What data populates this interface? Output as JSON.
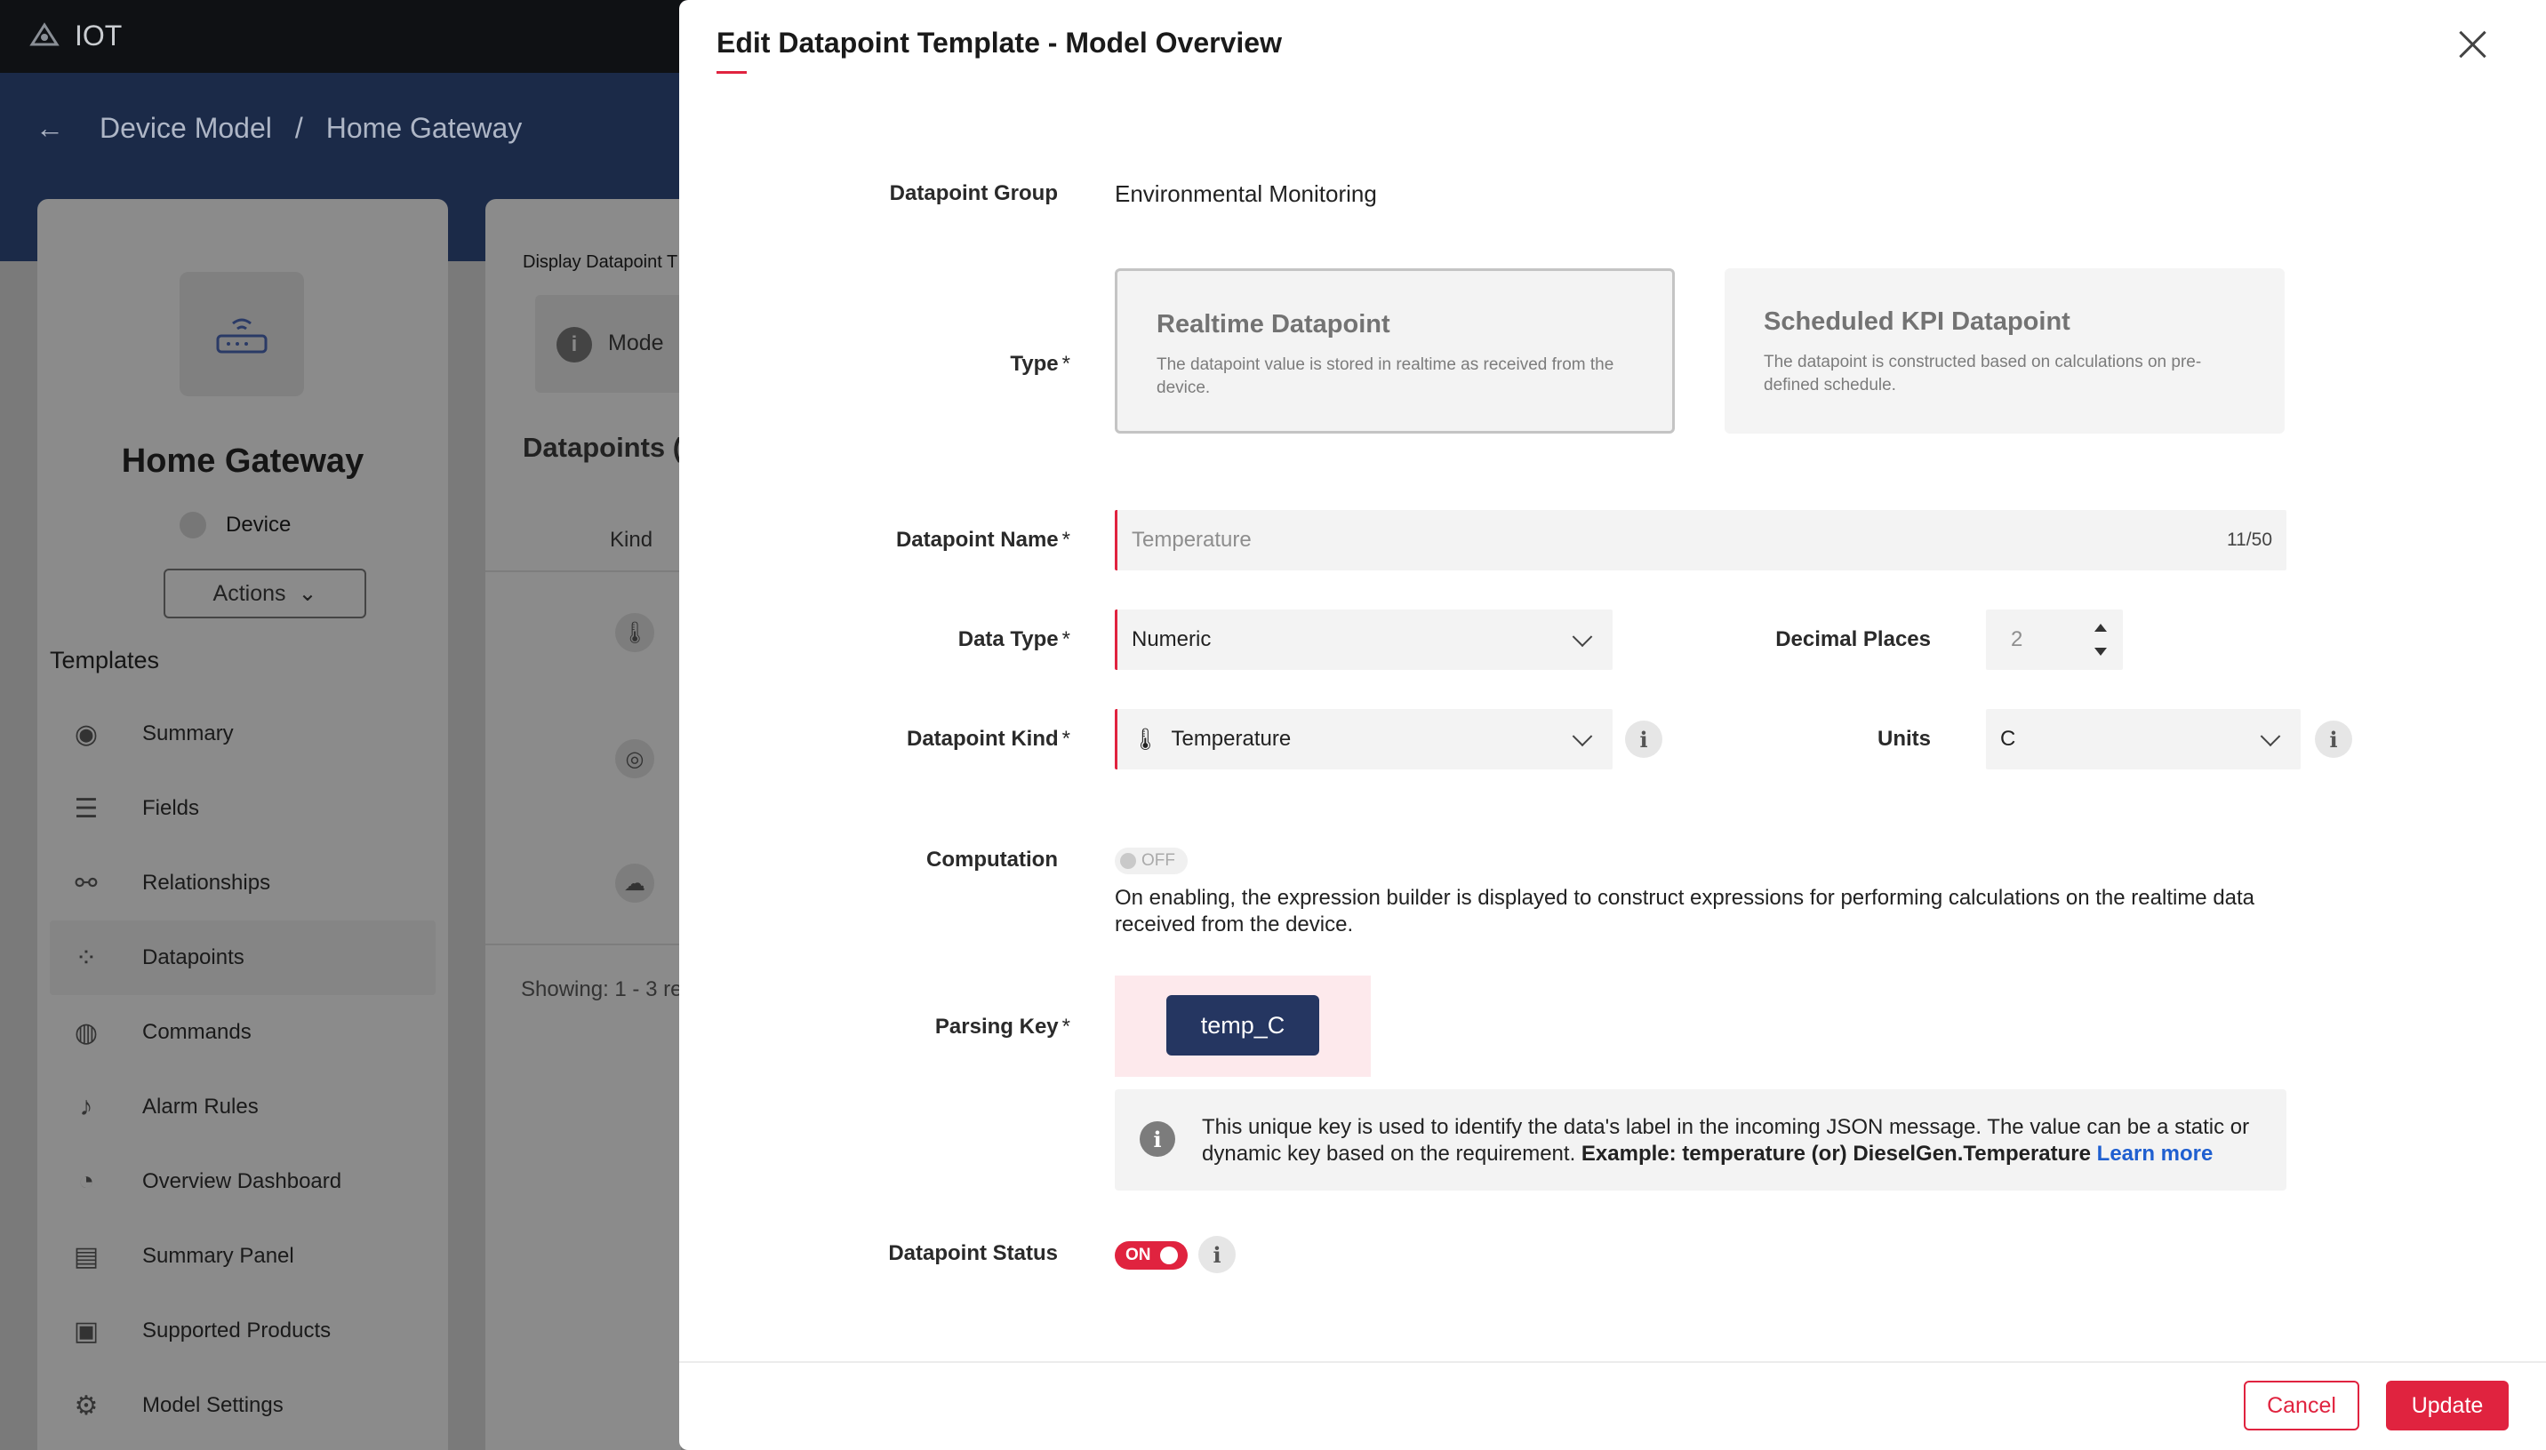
{
  "app": {
    "name": "IOT"
  },
  "breadcrumb": {
    "parent": "Device Model",
    "separator": "/",
    "current": "Home Gateway"
  },
  "device": {
    "name": "Home Gateway",
    "type": "Device",
    "actions_label": "Actions"
  },
  "sidebar": {
    "title": "Templates",
    "items": [
      {
        "label": "Summary",
        "icon": "eye-icon"
      },
      {
        "label": "Fields",
        "icon": "list-icon"
      },
      {
        "label": "Relationships",
        "icon": "link-icon"
      },
      {
        "label": "Datapoints",
        "icon": "datapoints-icon",
        "active": true
      },
      {
        "label": "Commands",
        "icon": "gamepad-icon"
      },
      {
        "label": "Alarm Rules",
        "icon": "bell-icon"
      },
      {
        "label": "Overview Dashboard",
        "icon": "dashboard-icon"
      },
      {
        "label": "Summary Panel",
        "icon": "id-card-icon"
      },
      {
        "label": "Supported Products",
        "icon": "box-icon"
      },
      {
        "label": "Model Settings",
        "icon": "gear-icon"
      }
    ]
  },
  "middle": {
    "display_label": "Display Datapoint T",
    "mode_text": "Mode",
    "datapoints_title": "Datapoints (",
    "kind_header": "Kind",
    "showing_prefix": "Showing:",
    "showing_range": "1 - 3 re"
  },
  "modal": {
    "title": "Edit Datapoint Template - Model Overview",
    "group_label": "Datapoint Group",
    "group_value": "Environmental Monitoring",
    "type_label": "Type",
    "type_options": [
      {
        "title": "Realtime Datapoint",
        "desc": "The datapoint value is stored in realtime as received from the device.",
        "selected": true
      },
      {
        "title": "Scheduled KPI Datapoint",
        "desc": "The datapoint is constructed based on calculations on pre-defined schedule.",
        "selected": false
      }
    ],
    "name_label": "Datapoint Name",
    "name_value": "Temperature",
    "name_counter": "11/50",
    "data_type_label": "Data Type",
    "data_type_value": "Numeric",
    "decimal_label": "Decimal Places",
    "decimal_value": "2",
    "kind_label": "Datapoint Kind",
    "kind_value": "Temperature",
    "units_label": "Units",
    "units_value": "C",
    "computation_label": "Computation",
    "computation_toggle": "OFF",
    "computation_desc": "On enabling, the expression builder is displayed to construct expressions for performing calculations on the realtime data received from the device.",
    "parsing_label": "Parsing Key",
    "parsing_value": "temp_C",
    "hint_text": "This unique key is used to identify the data's label in the incoming JSON message. The value can be a static or dynamic key based on the requirement.",
    "hint_example": "Example: temperature (or) DieselGen.Temperature",
    "hint_link": "Learn more",
    "status_label": "Datapoint Status",
    "status_toggle": "ON",
    "required_mark": "*",
    "info_glyph": "i",
    "cancel_label": "Cancel",
    "update_label": "Update"
  },
  "colors": {
    "accent": "#e0233f",
    "navy": "#253661",
    "link": "#1f5fd0"
  }
}
